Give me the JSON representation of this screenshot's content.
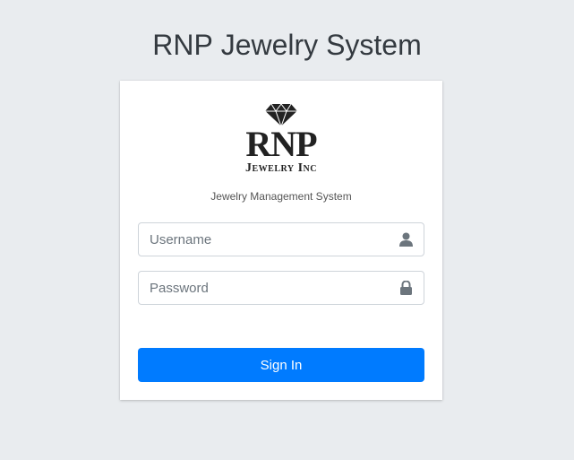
{
  "page": {
    "title_bold": "RNP",
    "title_rest": " Jewelry System"
  },
  "card": {
    "logo": {
      "main": "RNP",
      "sub": "Jewelry Inc",
      "icon": "diamond-icon"
    },
    "tagline": "Jewelry Management System",
    "username": {
      "placeholder": "Username",
      "value": "",
      "icon": "user-icon"
    },
    "password": {
      "placeholder": "Password",
      "value": "",
      "icon": "lock-icon"
    },
    "submit_label": "Sign In"
  },
  "colors": {
    "background": "#e9ecef",
    "card": "#ffffff",
    "primary_button": "#007bff",
    "icon_gray": "#6c757d"
  }
}
